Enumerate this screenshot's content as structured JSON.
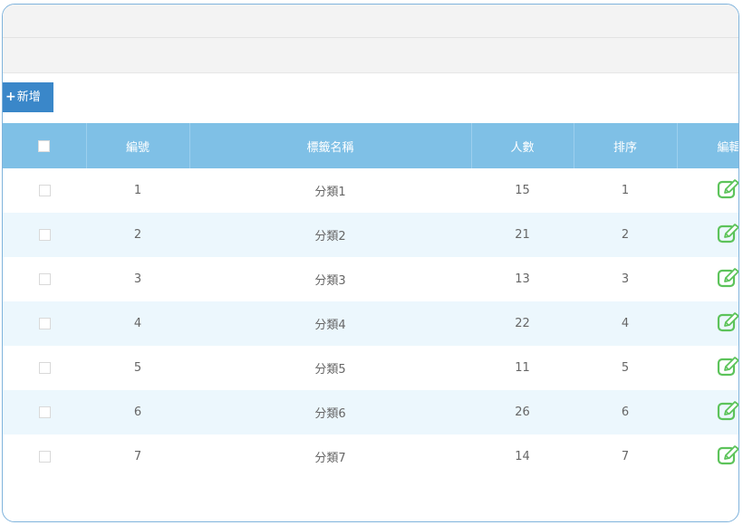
{
  "toolbar": {
    "add_label": "新增",
    "add_icon": "plus-icon"
  },
  "table": {
    "headers": {
      "id": "編號",
      "name": "標籤名稱",
      "count": "人數",
      "order": "排序",
      "edit": "編輯"
    },
    "rows": [
      {
        "id": "1",
        "name": "分類1",
        "count": "15",
        "order": "1"
      },
      {
        "id": "2",
        "name": "分類2",
        "count": "21",
        "order": "2"
      },
      {
        "id": "3",
        "name": "分類3",
        "count": "13",
        "order": "3"
      },
      {
        "id": "4",
        "name": "分類4",
        "count": "22",
        "order": "4"
      },
      {
        "id": "5",
        "name": "分類5",
        "count": "11",
        "order": "5"
      },
      {
        "id": "6",
        "name": "分類6",
        "count": "26",
        "order": "6"
      },
      {
        "id": "7",
        "name": "分類7",
        "count": "14",
        "order": "7"
      }
    ]
  },
  "colors": {
    "header_bg": "#7fc0e6",
    "add_button_bg": "#3a87c9",
    "stripe_bg": "#ecf7fd",
    "edit_icon": "#5cc35a"
  }
}
